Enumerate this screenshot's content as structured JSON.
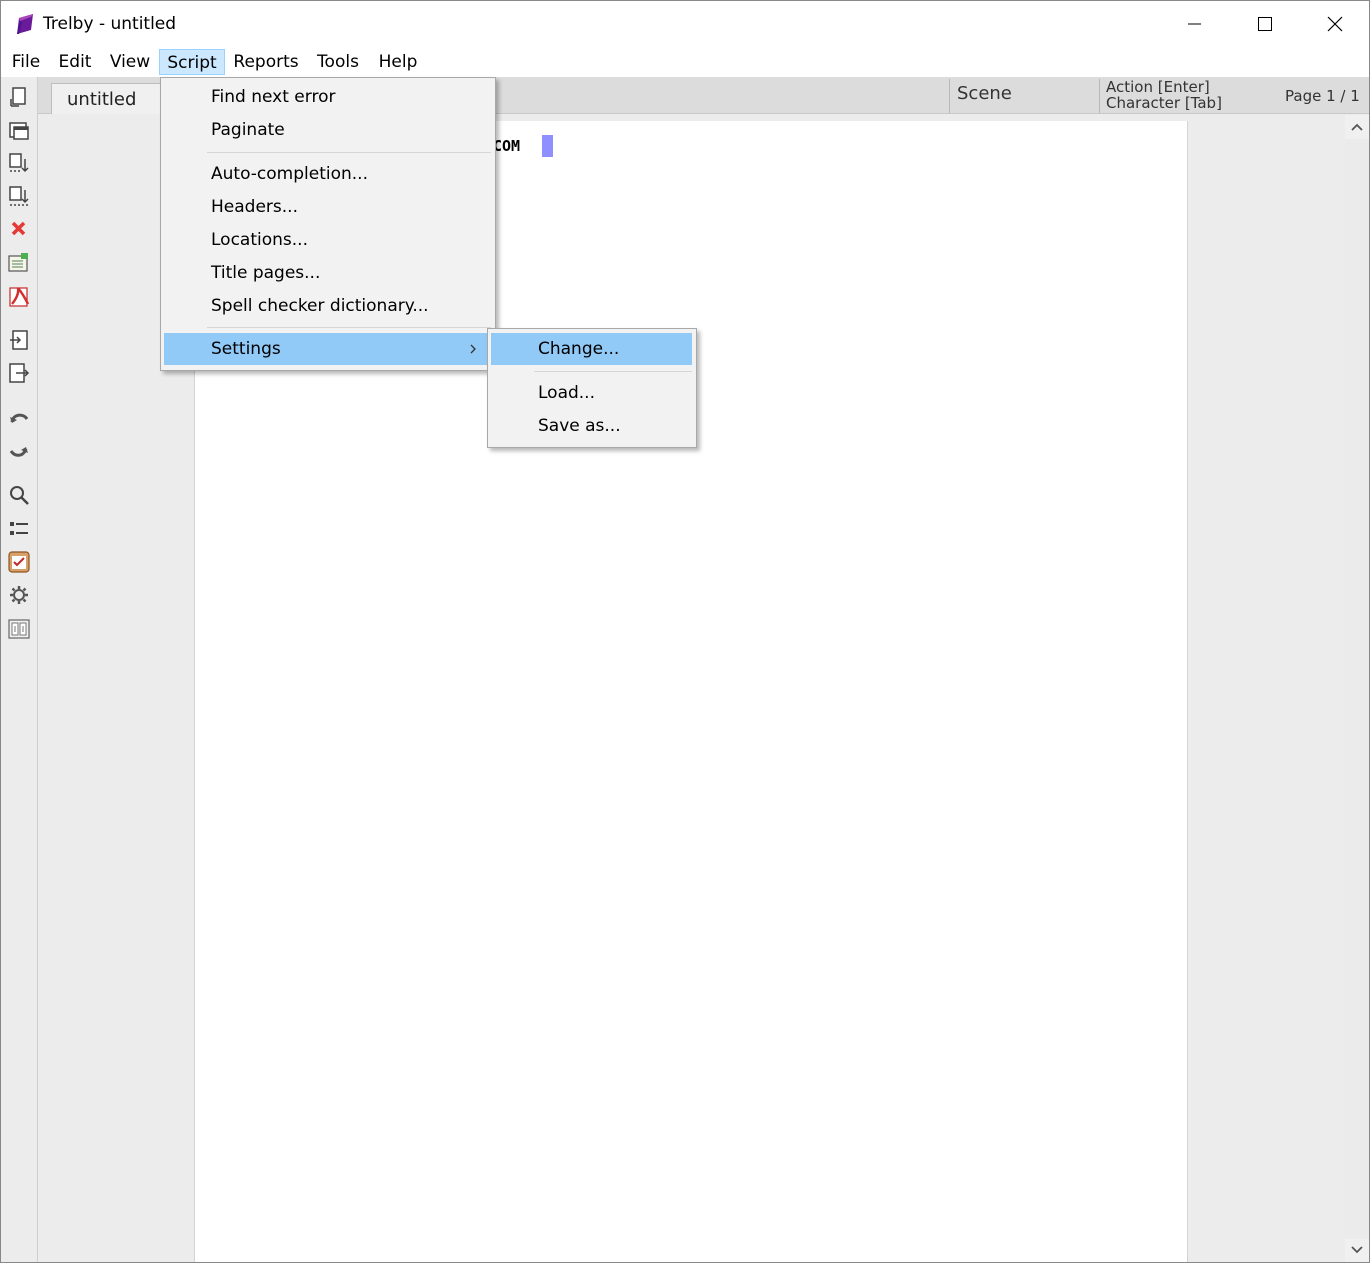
{
  "window": {
    "title": "Trelby - untitled",
    "controls": [
      "minimize-icon",
      "maximize-icon",
      "close-icon"
    ]
  },
  "menubar": {
    "items": [
      "File",
      "Edit",
      "View",
      "Script",
      "Reports",
      "Tools",
      "Help"
    ],
    "active": "Script"
  },
  "script_menu": {
    "items": [
      {
        "label": "Find next error"
      },
      {
        "label": "Paginate"
      },
      {
        "label": "Auto-completion..."
      },
      {
        "label": "Headers..."
      },
      {
        "label": "Locations..."
      },
      {
        "label": "Title pages..."
      },
      {
        "label": "Spell checker dictionary..."
      },
      {
        "label": "Settings",
        "submenu": true,
        "highlighted": true
      }
    ]
  },
  "settings_submenu": {
    "items": [
      {
        "label": "Change...",
        "highlighted": true
      },
      {
        "label": "Load..."
      },
      {
        "label": "Save as..."
      }
    ]
  },
  "document": {
    "tab_label": "untitled",
    "element_type": "Scene",
    "hint_enter": "Action [Enter]",
    "hint_tab": "Character [Tab]",
    "page_indicator": "Page 1 / 1",
    "visible_text": "COM"
  },
  "toolbar": {
    "icons": [
      "new-script-icon",
      "new-window-icon",
      "open-icon",
      "save-icon",
      "close-script-icon",
      "export-icon",
      "pdf-icon",
      "import-icon",
      "export-file-icon",
      "undo-icon",
      "redo-icon",
      "find-icon",
      "list-icon",
      "checklist-icon",
      "settings-gear-icon",
      "compare-icon"
    ]
  },
  "colors": {
    "menu_highlight": "#91c9f7",
    "active_menu": "#cce8ff",
    "cursor": "#8f8fff"
  }
}
